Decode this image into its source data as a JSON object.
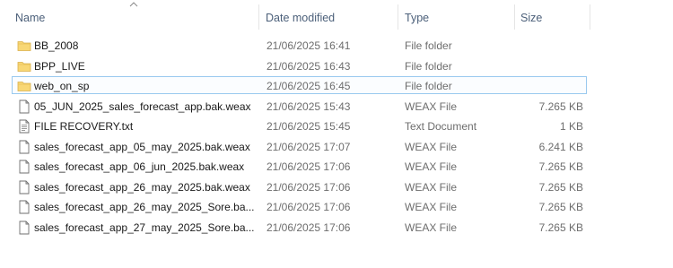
{
  "columns": {
    "name": "Name",
    "date_modified": "Date modified",
    "type": "Type",
    "size": "Size"
  },
  "sort": {
    "column": "name",
    "direction": "ascending"
  },
  "colors": {
    "folder": "#f6d77a",
    "selection_border": "#99c9ef",
    "header_text": "#4c607a"
  },
  "files": [
    {
      "name": "BB_2008",
      "date": "21/06/2025 16:41",
      "type": "File folder",
      "size": "",
      "icon": "folder-icon"
    },
    {
      "name": "BPP_LIVE",
      "date": "21/06/2025 16:43",
      "type": "File folder",
      "size": "",
      "icon": "folder-icon"
    },
    {
      "name": "web_on_sp",
      "date": "21/06/2025 16:45",
      "type": "File folder",
      "size": "",
      "icon": "folder-icon",
      "selected": true
    },
    {
      "name": "05_JUN_2025_sales_forecast_app.bak.weax",
      "date": "21/06/2025 15:43",
      "type": "WEAX File",
      "size": "7.265 KB",
      "icon": "file-icon"
    },
    {
      "name": "FILE RECOVERY.txt",
      "date": "21/06/2025 15:45",
      "type": "Text Document",
      "size": "1 KB",
      "icon": "text-file-icon"
    },
    {
      "name": "sales_forecast_app_05_may_2025.bak.weax",
      "date": "21/06/2025 17:07",
      "type": "WEAX File",
      "size": "6.241 KB",
      "icon": "file-icon"
    },
    {
      "name": "sales_forecast_app_06_jun_2025.bak.weax",
      "date": "21/06/2025 17:06",
      "type": "WEAX File",
      "size": "7.265 KB",
      "icon": "file-icon"
    },
    {
      "name": "sales_forecast_app_26_may_2025.bak.weax",
      "date": "21/06/2025 17:06",
      "type": "WEAX File",
      "size": "7.265 KB",
      "icon": "file-icon"
    },
    {
      "name": "sales_forecast_app_26_may_2025_Sore.ba...",
      "date": "21/06/2025 17:06",
      "type": "WEAX File",
      "size": "7.265 KB",
      "icon": "file-icon"
    },
    {
      "name": "sales_forecast_app_27_may_2025_Sore.ba...",
      "date": "21/06/2025 17:06",
      "type": "WEAX File",
      "size": "7.265 KB",
      "icon": "file-icon"
    }
  ]
}
